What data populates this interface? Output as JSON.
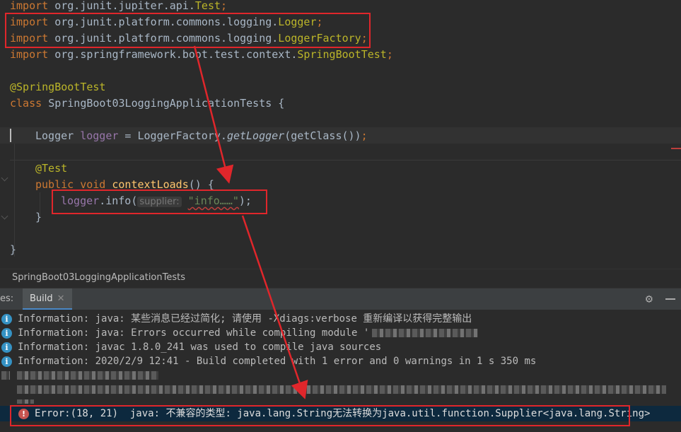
{
  "editor": {
    "lines": [
      {
        "import_kw": "import",
        "package": "org.junit.jupiter.api.",
        "cls": "Test",
        "semi": ";"
      },
      {
        "import_kw": "import",
        "package": "org.junit.platform.commons.logging.",
        "cls": "Logger",
        "semi": ";"
      },
      {
        "import_kw": "import",
        "package": "org.junit.platform.commons.logging.",
        "cls": "LoggerFactory",
        "semi": ";"
      },
      {
        "import_kw": "import",
        "package": "org.springframework.boot.test.context.",
        "cls": "SpringBootTest",
        "semi": ";"
      }
    ],
    "class_annotation": "@SpringBootTest",
    "class_kw": "class",
    "class_name": "SpringBoot03LoggingApplicationTests",
    "open_brace": " {",
    "field_type": "Logger",
    "field_name": "logger",
    "field_assign": " = ",
    "factory": "LoggerFactory.",
    "factory_method": "getLogger",
    "factory_args": "(getClass())",
    "field_semi": ";",
    "test_annotation": "@Test",
    "method_mods": "public void",
    "method_name": "contextLoads",
    "method_sig": "() {",
    "call_target": "logger",
    "call_method": ".info(",
    "param_hint": "supplier:",
    "call_arg": "\"info……\"",
    "call_end": ");",
    "method_close": "}",
    "class_close": "}"
  },
  "breadcrumb": "SpringBoot03LoggingApplicationTests",
  "tool_window": {
    "prefix": "es:",
    "tab_label": "Build",
    "tab_close": "✕"
  },
  "build_messages": [
    {
      "label": "Information:",
      "text": "java: 某些消息已经过简化; 请使用 -Xdiags:verbose 重新编译以获得完整输出"
    },
    {
      "label": "Information:",
      "text": "java: Errors occurred while compiling module '"
    },
    {
      "label": "Information:",
      "text": "javac 1.8.0_241 was used to compile java sources"
    },
    {
      "label": "Information:",
      "text": "2020/2/9 12:41 - Build completed with 1 error and 0 warnings in 1 s 350 ms"
    }
  ],
  "error_message": {
    "label": "Error:",
    "location": "(18, 21)",
    "text": "java: 不兼容的类型: java.lang.String无法转换为java.util.function.Supplier<java.lang.String>"
  },
  "colors": {
    "annotation_red": "#e0262b",
    "keyword": "#cc7832",
    "string": "#6a8759",
    "field": "#9876aa",
    "method": "#ffc66d"
  }
}
